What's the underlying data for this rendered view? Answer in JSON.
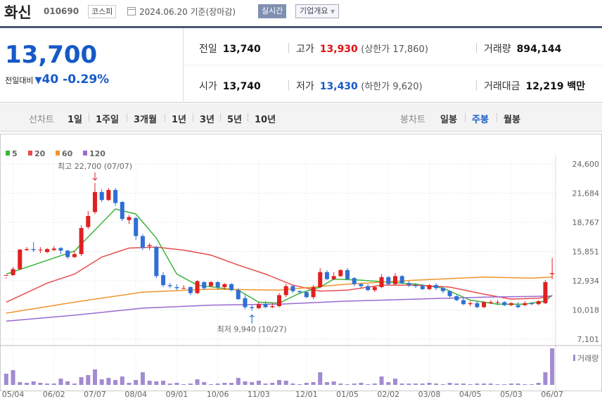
{
  "header": {
    "name": "화신",
    "code": "010690",
    "market": "코스피",
    "date": "2024.06.20 기준(장마감)",
    "realtime_label": "실시간",
    "company_label": "기업개요"
  },
  "quote": {
    "price": "13,700",
    "change_label": "전일대비",
    "change": "40",
    "change_pct": "-0.29%",
    "prev_close_label": "전일",
    "prev_close": "13,740",
    "high_label": "고가",
    "high": "13,930",
    "upper_limit_label": "(상한가 17,860)",
    "volume_label": "거래량",
    "volume": "894,144",
    "open_label": "시가",
    "open": "13,740",
    "low_label": "저가",
    "low": "13,430",
    "lower_limit_label": "(하한가 9,620)",
    "amount_label": "거래대금",
    "amount": "12,219 백만"
  },
  "periods": {
    "line_label": "선차트",
    "line_items": [
      "1일",
      "1주일",
      "3개월",
      "1년",
      "3년",
      "5년",
      "10년"
    ],
    "candle_label": "봉차트",
    "candle_items": [
      "일봉",
      "주봉",
      "월봉"
    ],
    "candle_selected": 1
  },
  "chart_data": {
    "type": "candlestick",
    "legend": [
      {
        "name": "5",
        "color": "#3cb43c"
      },
      {
        "name": "20",
        "color": "#e84c4c"
      },
      {
        "name": "60",
        "color": "#f0952a"
      },
      {
        "name": "120",
        "color": "#9a6ad0"
      }
    ],
    "y_ticks": [
      "24,600",
      "21,684",
      "18,767",
      "15,851",
      "12,934",
      "10,018",
      "7,101"
    ],
    "y_tick_values": [
      24600,
      21684,
      18767,
      15851,
      12934,
      10018,
      7101
    ],
    "ylim": [
      7101,
      24600
    ],
    "x_ticks": [
      "05/04",
      "06/02",
      "07/07",
      "08/04",
      "09/01",
      "10/06",
      "11/03",
      "12/01",
      "01/05",
      "02/02",
      "03/08",
      "04/05",
      "05/03",
      "06/07"
    ],
    "high_annotation": "최고 22,700 (07/07)",
    "low_annotation": "최저 9,940 (10/27)",
    "volume_label": "거래량",
    "up_color": "#e02020",
    "down_color": "#2f6fd6",
    "candles": [
      [
        13500,
        13500,
        13300,
        13150
      ],
      [
        13500,
        14100,
        14300,
        13400
      ],
      [
        14100,
        16050,
        16100,
        14000
      ],
      [
        16000,
        16100,
        16300,
        15900
      ],
      [
        16100,
        16000,
        16800,
        15800
      ],
      [
        16000,
        16050,
        16300,
        15700
      ],
      [
        15800,
        16100,
        16200,
        15700
      ],
      [
        16000,
        16150,
        16400,
        15900
      ],
      [
        16200,
        15950,
        16300,
        15600
      ],
      [
        15950,
        15300,
        16000,
        15100
      ],
      [
        15300,
        15600,
        15900,
        15200
      ],
      [
        15600,
        18200,
        18500,
        15400
      ],
      [
        18300,
        19400,
        19900,
        18100
      ],
      [
        19800,
        21800,
        22700,
        19600
      ],
      [
        21800,
        21000,
        22100,
        20800
      ],
      [
        21000,
        22000,
        22200,
        20900
      ],
      [
        22000,
        20700,
        22200,
        20400
      ],
      [
        20800,
        19100,
        20900,
        18900
      ],
      [
        19000,
        19300,
        19500,
        18600
      ],
      [
        19200,
        17400,
        19300,
        17000
      ],
      [
        17400,
        16200,
        17600,
        16000
      ],
      [
        16400,
        16500,
        16700,
        16000
      ],
      [
        16300,
        13400,
        16400,
        13200
      ],
      [
        13500,
        12500,
        13800,
        12300
      ],
      [
        12500,
        12400,
        12700,
        12200
      ],
      [
        12300,
        12200,
        12600,
        12000
      ],
      [
        12200,
        12200,
        12500,
        12100
      ],
      [
        12300,
        11700,
        12400,
        11500
      ],
      [
        11700,
        12900,
        13000,
        11600
      ],
      [
        12800,
        12200,
        12900,
        12000
      ],
      [
        12400,
        12800,
        12900,
        12300
      ],
      [
        12800,
        12300,
        12900,
        12100
      ],
      [
        12300,
        12600,
        12700,
        12100
      ],
      [
        12600,
        12000,
        12700,
        11900
      ],
      [
        12000,
        11100,
        12200,
        11000
      ],
      [
        11200,
        10300,
        11500,
        10100
      ],
      [
        10300,
        10200,
        10500,
        9940
      ],
      [
        10200,
        10600,
        10800,
        10100
      ],
      [
        10600,
        10300,
        10900,
        10200
      ],
      [
        10300,
        10400,
        10700,
        10200
      ],
      [
        10400,
        11500,
        11700,
        10300
      ],
      [
        11500,
        12400,
        12600,
        11300
      ],
      [
        12400,
        11900,
        12500,
        11700
      ],
      [
        11900,
        11800,
        12000,
        11600
      ],
      [
        11800,
        11300,
        11900,
        11200
      ],
      [
        11300,
        12300,
        12500,
        11100
      ],
      [
        12300,
        13800,
        14200,
        12200
      ],
      [
        13800,
        13100,
        14000,
        13000
      ],
      [
        13100,
        13400,
        13800,
        13000
      ],
      [
        13400,
        14000,
        14100,
        13300
      ],
      [
        14000,
        13100,
        14200,
        13000
      ],
      [
        13200,
        12600,
        13300,
        12400
      ],
      [
        12600,
        12400,
        12700,
        12200
      ],
      [
        12400,
        12000,
        12600,
        11900
      ],
      [
        12000,
        12300,
        12400,
        11800
      ],
      [
        12300,
        13300,
        13600,
        12200
      ],
      [
        13300,
        12600,
        13400,
        12500
      ],
      [
        12600,
        13400,
        13700,
        12500
      ],
      [
        13400,
        12700,
        13500,
        12600
      ],
      [
        12700,
        12500,
        12900,
        12300
      ],
      [
        12500,
        12400,
        12700,
        12200
      ],
      [
        12400,
        12100,
        12600,
        12000
      ],
      [
        12100,
        12500,
        12600,
        12000
      ],
      [
        12500,
        12200,
        12700,
        12000
      ],
      [
        12200,
        11900,
        12300,
        11700
      ],
      [
        11900,
        11400,
        12000,
        11200
      ],
      [
        11400,
        11000,
        11500,
        10900
      ],
      [
        11000,
        10600,
        11200,
        10500
      ],
      [
        10600,
        10700,
        10900,
        10400
      ],
      [
        10700,
        10300,
        10900,
        10200
      ],
      [
        10300,
        10800,
        10900,
        10200
      ],
      [
        10700,
        10800,
        11000,
        10600
      ],
      [
        10800,
        10800,
        11000,
        10500
      ],
      [
        10800,
        10500,
        10900,
        10400
      ],
      [
        10500,
        10700,
        10800,
        10400
      ],
      [
        10500,
        10300,
        10800,
        10200
      ],
      [
        10500,
        10700,
        10900,
        10400
      ],
      [
        10700,
        10600,
        10800,
        10500
      ],
      [
        10600,
        10900,
        11000,
        10500
      ],
      [
        10700,
        12800,
        13000,
        10600
      ],
      [
        13600,
        13700,
        15200,
        13100
      ]
    ],
    "volumes": [
      16,
      21,
      4,
      3,
      5,
      3,
      2,
      2,
      9,
      5,
      2,
      11,
      14,
      22,
      8,
      10,
      7,
      12,
      3,
      7,
      18,
      6,
      5,
      6,
      2,
      3,
      1,
      2,
      8,
      4,
      1,
      2,
      3,
      3,
      10,
      5,
      4,
      6,
      2,
      3,
      7,
      6,
      2,
      1,
      3,
      4,
      18,
      4,
      5,
      2,
      1,
      2,
      3,
      1,
      2,
      12,
      4,
      9,
      2,
      2,
      2,
      2,
      3,
      2,
      1,
      3,
      2,
      2,
      1,
      2,
      2,
      2,
      1,
      1,
      2,
      2,
      1,
      1,
      3,
      18,
      52
    ],
    "ma": {
      "5": [
        [
          0,
          13600
        ],
        [
          10,
          15900
        ],
        [
          13,
          18000
        ],
        [
          16,
          20100
        ],
        [
          19,
          19600
        ],
        [
          22,
          17200
        ],
        [
          25,
          13600
        ],
        [
          28,
          12500
        ],
        [
          34,
          12000
        ],
        [
          37,
          10800
        ],
        [
          40,
          10700
        ],
        [
          43,
          11700
        ],
        [
          46,
          12300
        ],
        [
          48,
          13100
        ],
        [
          52,
          13000
        ],
        [
          56,
          12800
        ],
        [
          60,
          12600
        ],
        [
          64,
          12200
        ],
        [
          68,
          11000
        ],
        [
          72,
          10600
        ],
        [
          76,
          10600
        ],
        [
          79,
          10900
        ],
        [
          80,
          11500
        ]
      ],
      "20": [
        [
          0,
          10800
        ],
        [
          6,
          12700
        ],
        [
          10,
          13600
        ],
        [
          14,
          15300
        ],
        [
          18,
          16200
        ],
        [
          22,
          16300
        ],
        [
          26,
          16000
        ],
        [
          30,
          15500
        ],
        [
          34,
          14500
        ],
        [
          38,
          13600
        ],
        [
          42,
          12500
        ],
        [
          46,
          11900
        ],
        [
          50,
          12000
        ],
        [
          55,
          12500
        ],
        [
          60,
          12500
        ],
        [
          65,
          12300
        ],
        [
          70,
          11600
        ],
        [
          74,
          11100
        ],
        [
          78,
          11200
        ],
        [
          80,
          11400
        ]
      ],
      "60": [
        [
          0,
          9700
        ],
        [
          10,
          10800
        ],
        [
          20,
          11800
        ],
        [
          30,
          12100
        ],
        [
          40,
          12000
        ],
        [
          50,
          12600
        ],
        [
          60,
          13000
        ],
        [
          70,
          13300
        ],
        [
          77,
          13200
        ],
        [
          80,
          13300
        ]
      ],
      "120": [
        [
          0,
          8900
        ],
        [
          10,
          9500
        ],
        [
          20,
          10200
        ],
        [
          30,
          10500
        ],
        [
          40,
          10600
        ],
        [
          50,
          10900
        ],
        [
          60,
          11100
        ],
        [
          70,
          11300
        ],
        [
          80,
          11400
        ]
      ]
    }
  }
}
